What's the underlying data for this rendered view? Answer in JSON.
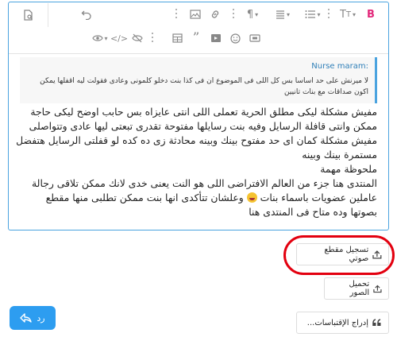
{
  "editor": {
    "quote": {
      "author": "Nurse maram:",
      "text": "لا ميرنش على حد اساسا بس كل اللى فى الموضوع ان فى كذا بنت دخلو كلمونى وعادى فقولت ليه اقفلها يمكن اكون صداقات مع بنات تانيين"
    },
    "body_lines": [
      "مفيش مشكلة ليكى مطلق الحرية تعملى اللى انتى عايزاه بس حابب اوضح ليكى حاجة",
      "ممكن وانتى قافلة الرسايل وفيه بنت رسايلها مفتوحة تقدرى تبعتى ليها عادى وتتواصلى",
      "مفيش مشكلة كمان اى حد مفتوح بينك وبينه محادثة زى ده كده لو قفلتى الرسايل هتفضل",
      "مستمرة بينك وبينه",
      "ملحوظة مهمة",
      "المنتدى هنا جزء من العالم الافتراضى اللى هو النت يعنى خدى لانك ممكن تلاقى رجالة",
      "بصوتها وده متاح فى المنتدى هنا"
    ],
    "body_line_emoji": {
      "before": "عاملين عضويات باسماء بنات ",
      "after": " وعلشان تتأكدى انها بنت ممكن تطلبى منها مقطع"
    }
  },
  "attachments": {
    "voice_label": "تسجيل مقطع صوتي",
    "images_label": "تحميل الصور",
    "insert_label": "إدراج الإقتباسات..."
  },
  "reply": {
    "label": "رد"
  },
  "colors": {
    "accent": "#2d9df0",
    "highlight": "#e3000f",
    "border": "#4aa3df"
  }
}
